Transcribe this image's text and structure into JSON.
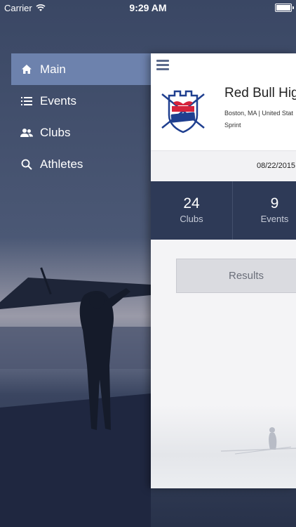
{
  "status_bar": {
    "carrier": "Carrier",
    "time": "9:29 AM"
  },
  "menu": {
    "items": [
      {
        "label": "Main",
        "icon": "home-icon",
        "active": true
      },
      {
        "label": "Events",
        "icon": "list-icon",
        "active": false
      },
      {
        "label": "Clubs",
        "icon": "people-icon",
        "active": false
      },
      {
        "label": "Athletes",
        "icon": "search-icon",
        "active": false
      }
    ]
  },
  "event": {
    "title": "Red Bull Hig",
    "location": "Boston, MA | United Stat",
    "type": "Sprint",
    "date": "08/22/2015"
  },
  "stats": [
    {
      "value": "24",
      "label": "Clubs"
    },
    {
      "value": "9",
      "label": "Events"
    }
  ],
  "results_label": "Results",
  "colors": {
    "menu_active": "#6d82ad",
    "stats_bg": "#2e3a57",
    "background": "#3d4a66"
  }
}
